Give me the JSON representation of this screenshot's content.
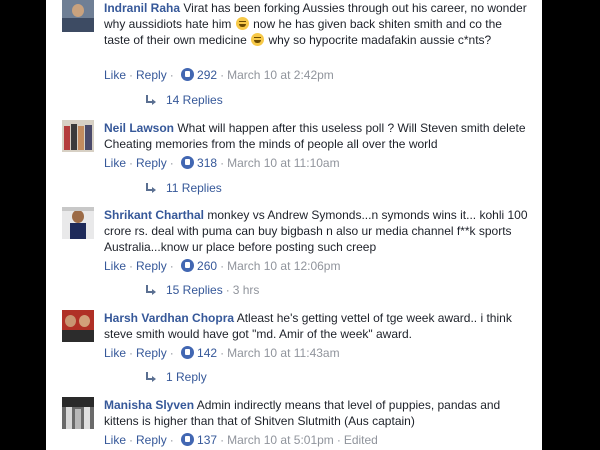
{
  "comments": [
    {
      "author": "Indranil Raha",
      "text_before_1": "Virat has been forking Aussies through out his career, no wonder why aussidiots hate him",
      "text_mid": "now he has given back shiten smith and co the taste of their own medicine",
      "text_after": "why so hypocrite madafakin aussie c*nts?",
      "like": "Like",
      "reply": "Reply",
      "reactions": "292",
      "timestamp": "March 10 at 2:42pm",
      "replies": "14 Replies",
      "emoji_icon": "laughing-face-icon"
    },
    {
      "author": "Neil Lawson",
      "text": "What will happen after this useless poll ? Will Steven smith delete Cheating memories from the minds of people all over the world",
      "like": "Like",
      "reply": "Reply",
      "reactions": "318",
      "timestamp": "March 10 at 11:10am",
      "replies": "11 Replies"
    },
    {
      "author": "Shrikant Charthal",
      "text": "monkey vs Andrew Symonds...n symonds wins it... kohli 100 crore rs. deal with puma can buy bigbash n also ur media channel f**k sports Australia...know ur place before posting such creep",
      "like": "Like",
      "reply": "Reply",
      "reactions": "260",
      "timestamp": "March 10 at 12:06pm",
      "replies": "15 Replies",
      "replies_time": "3 hrs"
    },
    {
      "author": "Harsh Vardhan Chopra",
      "text": "Atleast he's getting vettel of tge week award.. i think steve smith would have got \"md. Amir of the week\" award.",
      "like": "Like",
      "reply": "Reply",
      "reactions": "142",
      "timestamp": "March 10 at 11:43am",
      "replies": "1 Reply"
    },
    {
      "author": "Manisha Slyven",
      "text": "Admin indirectly means that level of puppies, pandas and kittens is higher than that of Shitven Slutmith (Aus captain)",
      "like": "Like",
      "reply": "Reply",
      "reactions": "137",
      "timestamp": "March 10 at 5:01pm",
      "edited": "Edited"
    }
  ],
  "colors": {
    "author": "#365899",
    "text": "#1d2129",
    "meta": "#90949c",
    "like_icon": "#4267b2",
    "background": "#000000"
  }
}
